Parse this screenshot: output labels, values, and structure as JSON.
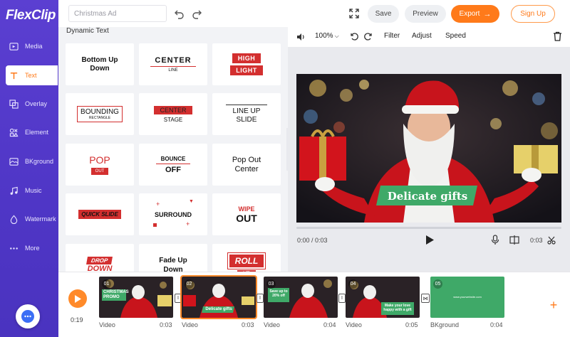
{
  "app": {
    "logo": "FlexClip"
  },
  "sidebar": {
    "items": [
      {
        "label": "Media",
        "icon": "media-icon"
      },
      {
        "label": "Text",
        "icon": "text-icon",
        "active": true
      },
      {
        "label": "Overlay",
        "icon": "overlay-icon"
      },
      {
        "label": "Element",
        "icon": "element-icon"
      },
      {
        "label": "BKground",
        "icon": "background-icon"
      },
      {
        "label": "Music",
        "icon": "music-icon"
      },
      {
        "label": "Watermark",
        "icon": "watermark-icon"
      },
      {
        "label": "More",
        "icon": "more-icon"
      }
    ]
  },
  "topbar": {
    "title_value": "Christmas Ad",
    "save_label": "Save",
    "preview_label": "Preview",
    "export_label": "Export",
    "signup_label": "Sign Up"
  },
  "panel": {
    "title": "Dynamic Text",
    "tiles": [
      {
        "l1": "Bottom Up",
        "l2": "Down"
      },
      {
        "l1": "CENTER",
        "l2": "LINE"
      },
      {
        "l1": "HIGH",
        "l2": "LIGHT"
      },
      {
        "l1": "BOUNDING",
        "l2": "RECTANGLE"
      },
      {
        "l1": "CENTER",
        "l2": "STAGE"
      },
      {
        "l1": "LINE UP",
        "l2": "SLIDE"
      },
      {
        "l1": "POP",
        "l2": "OUT"
      },
      {
        "l1": "BOUNCE",
        "l2": "OFF"
      },
      {
        "l1": "Pop Out",
        "l2": "Center"
      },
      {
        "l1": "QUICK SLIDE"
      },
      {
        "l1": "SURROUND"
      },
      {
        "l1": "WIPE",
        "l2": "OUT"
      },
      {
        "l1": "DROP",
        "l2": "DOWN"
      },
      {
        "l1": "Fade Up",
        "l2": "Down"
      },
      {
        "l1": "ROLL",
        "l2": "UP"
      }
    ]
  },
  "preview_toolbar": {
    "zoom": "100%",
    "filter_label": "Filter",
    "adjust_label": "Adjust",
    "speed_label": "Speed"
  },
  "preview": {
    "caption": "Delicate gifts",
    "time_current": "0:00 / 0:03",
    "time_clip": "0:03"
  },
  "timeline": {
    "total_time": "0:19",
    "clips": [
      {
        "num": "01",
        "label": "Video",
        "dur": "0:03",
        "caption": "CHRISTMAS PROMO"
      },
      {
        "num": "02",
        "label": "Video",
        "dur": "0:03",
        "caption": "Delicate gifts"
      },
      {
        "num": "03",
        "label": "Video",
        "dur": "0:04",
        "caption": "Save up to 20% off"
      },
      {
        "num": "04",
        "label": "Video",
        "dur": "0:05",
        "caption": "Make your love happy with a gift"
      },
      {
        "num": "05",
        "label": "BKground",
        "dur": "0:04",
        "caption": "www.yourwebsite.com"
      }
    ]
  },
  "colors": {
    "accent": "#ff7a1a",
    "sidebar": "#5139c9",
    "green": "#3fa968",
    "red": "#d32f2f"
  }
}
